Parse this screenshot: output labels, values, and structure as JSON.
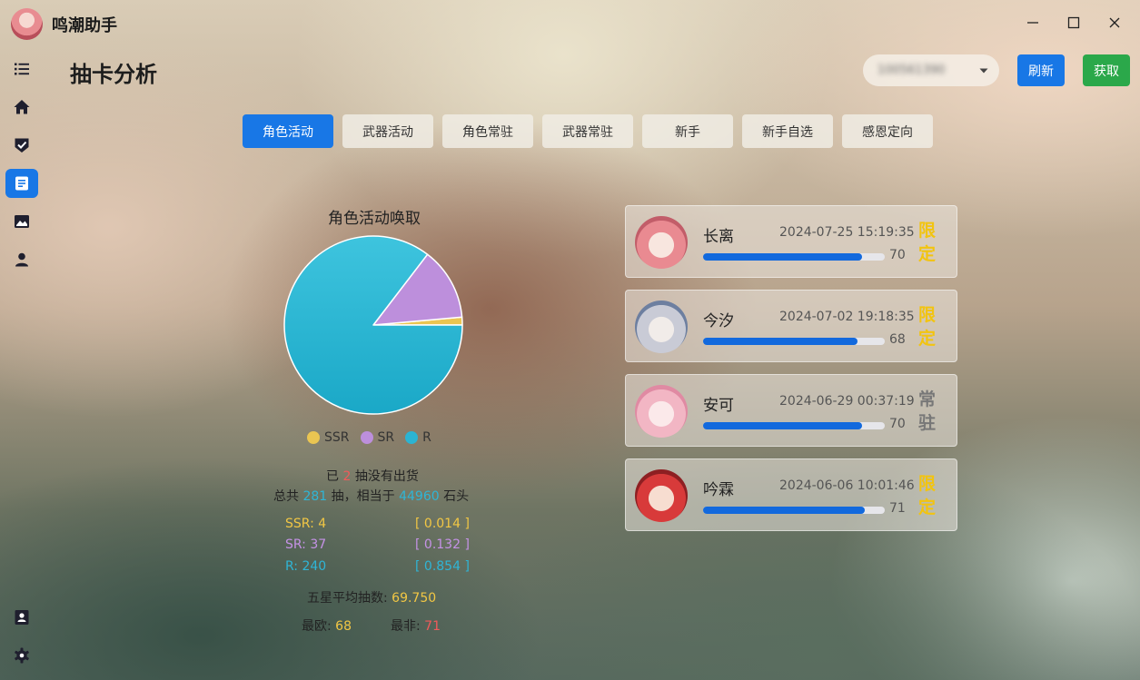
{
  "app": {
    "title": "鸣潮助手"
  },
  "page": {
    "title": "抽卡分析"
  },
  "header": {
    "uid_value": "100561390",
    "refresh_label": "刷新",
    "fetch_label": "获取"
  },
  "tabs": [
    {
      "label": "角色活动",
      "active": true
    },
    {
      "label": "武器活动",
      "active": false
    },
    {
      "label": "角色常驻",
      "active": false
    },
    {
      "label": "武器常驻",
      "active": false
    },
    {
      "label": "新手",
      "active": false
    },
    {
      "label": "新手自选",
      "active": false
    },
    {
      "label": "感恩定向",
      "active": false
    }
  ],
  "chart_data": {
    "type": "pie",
    "title": "角色活动唤取",
    "series": [
      {
        "name": "SSR",
        "value": 4,
        "color": "#eac552"
      },
      {
        "name": "SR",
        "value": 37,
        "color": "#bd8fdc"
      },
      {
        "name": "R",
        "value": 240,
        "color": "#2bb4d3"
      }
    ],
    "legend_position": "bottom"
  },
  "summary": {
    "line1_prefix": "已",
    "pity_count": "2",
    "line1_suffix": "抽没有出货",
    "line2_prefix": "总共",
    "total_pulls": "281",
    "line2_mid": "抽，相当于",
    "stones": "44960",
    "line2_suffix": "石头"
  },
  "rates": [
    {
      "label": "SSR: 4",
      "rate": "[ 0.014 ]"
    },
    {
      "label": "SR: 37",
      "rate": "[ 0.132 ]"
    },
    {
      "label": "R: 240",
      "rate": "[ 0.854 ]"
    }
  ],
  "averages": {
    "avg_label": "五星平均抽数:",
    "avg_value": "69.750",
    "best_label": "最欧:",
    "best_value": "68",
    "worst_label": "最非:",
    "worst_value": "71"
  },
  "pulls": [
    {
      "name": "长离",
      "time": "2024-07-25 15:19:35",
      "count": 70,
      "count_label": "70",
      "tag": "限定",
      "tag_type": "limited"
    },
    {
      "name": "今汐",
      "time": "2024-07-02 19:18:35",
      "count": 68,
      "count_label": "68",
      "tag": "限定",
      "tag_type": "limited"
    },
    {
      "name": "安可",
      "time": "2024-06-29 00:37:19",
      "count": 70,
      "count_label": "70",
      "tag": "常驻",
      "tag_type": "standard"
    },
    {
      "name": "吟霖",
      "time": "2024-06-06 10:01:46",
      "count": 71,
      "count_label": "71",
      "tag": "限定",
      "tag_type": "limited"
    }
  ],
  "pity_max": 80,
  "icons": {
    "sidebar": [
      "list-icon",
      "home-icon",
      "shield-check-icon",
      "document-icon",
      "image-icon",
      "user-icon",
      "contact-card-icon",
      "settings-icon"
    ],
    "window": [
      "minimize-icon",
      "maximize-icon",
      "close-icon"
    ]
  }
}
